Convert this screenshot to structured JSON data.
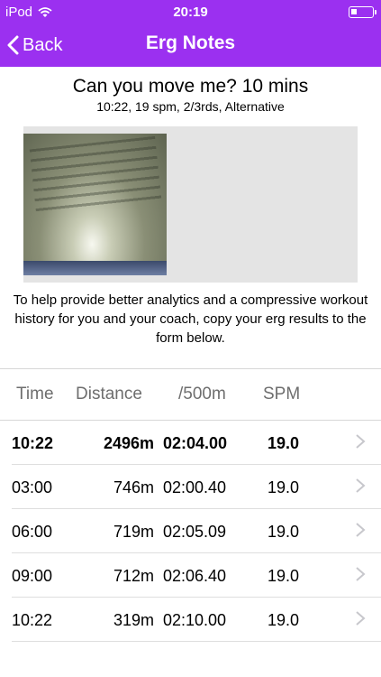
{
  "status_bar": {
    "carrier": "iPod",
    "time": "20:19"
  },
  "nav": {
    "back_label": "Back",
    "title": "Erg Notes"
  },
  "workout": {
    "title": "Can you move me? 10 mins",
    "subtitle": "10:22, 19 spm, 2/3rds, Alternative"
  },
  "help_text": "To help provide better analytics and a compressive workout history for you and your coach, copy your erg results to the form below.",
  "table": {
    "headers": {
      "time": "Time",
      "distance": "Distance",
      "pace": "/500m",
      "spm": "SPM"
    },
    "rows": [
      {
        "time": "10:22",
        "distance": "2496m",
        "pace": "02:04.00",
        "spm": "19.0"
      },
      {
        "time": "03:00",
        "distance": "746m",
        "pace": "02:00.40",
        "spm": "19.0"
      },
      {
        "time": "06:00",
        "distance": "719m",
        "pace": "02:05.09",
        "spm": "19.0"
      },
      {
        "time": "09:00",
        "distance": "712m",
        "pace": "02:06.40",
        "spm": "19.0"
      },
      {
        "time": "10:22",
        "distance": "319m",
        "pace": "02:10.00",
        "spm": "19.0"
      }
    ]
  },
  "colors": {
    "accent": "#9b30f0"
  },
  "icons": {
    "back": "chevron-left-icon",
    "row": "chevron-right-icon",
    "wifi": "wifi-icon",
    "battery": "battery-icon"
  }
}
